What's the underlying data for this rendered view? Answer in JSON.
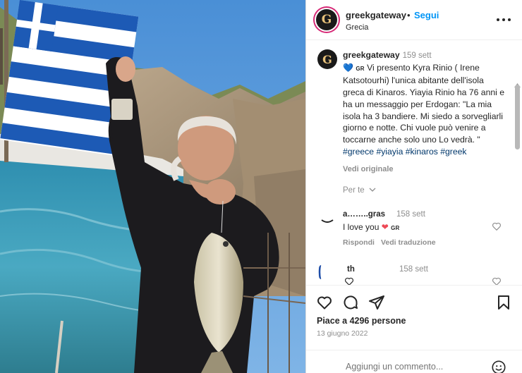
{
  "post_image": {
    "alt_subject": "photo"
  },
  "header": {
    "username": "greekgateway",
    "dot": "•",
    "follow_label": "Segui",
    "location": "Grecia",
    "avatar_letter": "G"
  },
  "caption": {
    "username": "greekgateway",
    "time": "159 sett",
    "flag": "GR",
    "text": "Vi presento Kyra Rinio ( Irene Katsotourhi) l'unica abitante dell'isola greca di Kinaros. Yiayia Rinio ha 76 anni e ha un messaggio per Erdogan: \"La mia isola ha 3 bandiere. Mi siedo a sorvegliarli giorno e notte. Chi vuole può venire a toccarne anche solo uno Lo vedrà. \" ",
    "hashtags": [
      "#greece",
      "#yiayia",
      "#kinaros",
      "#greek"
    ],
    "see_original": "Vedi originale",
    "for_you": "Per te"
  },
  "comments": [
    {
      "username": "a……..gras",
      "time": "158 sett",
      "text": "I love you",
      "flag": "GR",
      "reply_label": "Rispondi",
      "translate_label": "Vedi traduzione"
    },
    {
      "username": "th",
      "time": "158 sett"
    }
  ],
  "footer": {
    "likes": "Piace a 4296 persone",
    "date": "13 giugno 2022",
    "comment_placeholder": "Aggiungi un commento..."
  },
  "colors": {
    "accent": "#0095f6",
    "hashtag": "#00376b",
    "muted": "#8e8e8e",
    "heart_red": "#ed4956",
    "heart_blue": "#3897f0"
  }
}
